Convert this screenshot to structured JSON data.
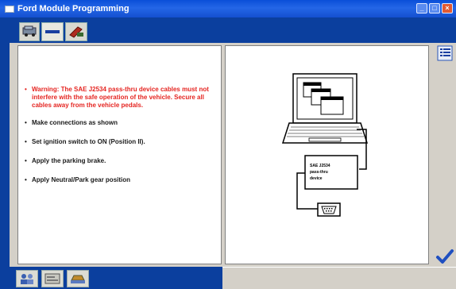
{
  "window": {
    "title": "Ford Module Programming"
  },
  "toolbar": {
    "tabs": [
      {
        "icon": "vehicle-icon"
      },
      {
        "icon": "dash-icon"
      },
      {
        "icon": "wrench-icon"
      }
    ]
  },
  "instructions": {
    "warning": "Warning: The SAE J2534 pass-thru device cables must not interfere with the safe operation of the vehicle. Secure all cables away from the vehicle pedals.",
    "steps": [
      "Make connections as shown",
      "Set ignition switch to ON (Position II).",
      "Apply the parking brake.",
      "Apply Neutral/Park gear position"
    ]
  },
  "diagram": {
    "device_label_lines": [
      "SAE J2534",
      "pass-thru",
      "device"
    ]
  },
  "colors": {
    "warning_text": "#e52521",
    "frame_blue": "#0b3f9e",
    "titlebar_blue": "#1450d0"
  },
  "bottom": {
    "tabs": [
      {
        "icon": "users-icon"
      },
      {
        "icon": "card-icon"
      },
      {
        "icon": "vehicle-lift-icon"
      }
    ]
  }
}
